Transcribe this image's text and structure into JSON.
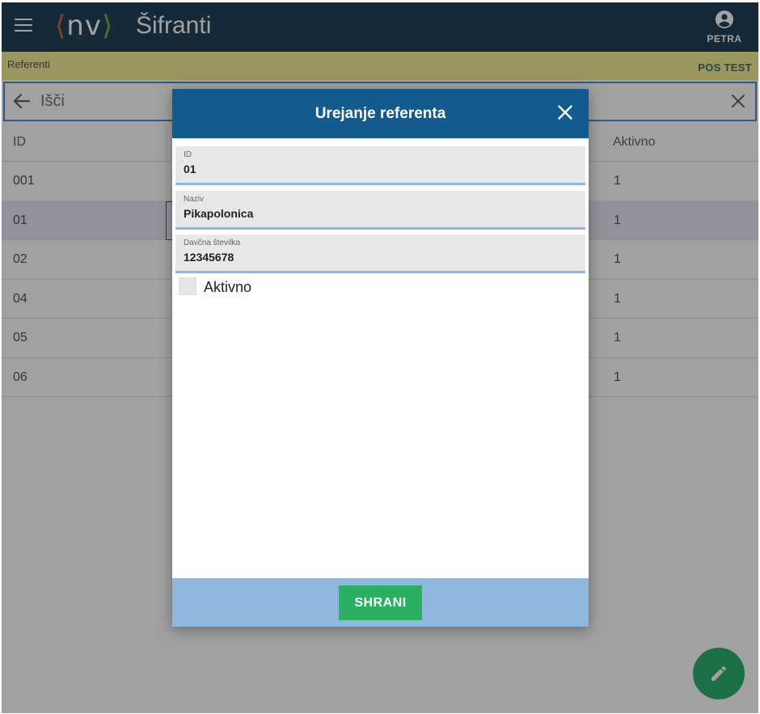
{
  "header": {
    "logo_open": "⟨",
    "logo_text": "nv",
    "logo_close": "⟩",
    "title": "Šifranti",
    "user_name": "PETRA",
    "menu_icon": "hamburger-menu-icon",
    "user_icon": "account-circle-icon"
  },
  "info_strip": {
    "breadcrumb": "Referenti",
    "environment": "POS TEST"
  },
  "search": {
    "placeholder": "Išči",
    "value": ""
  },
  "table": {
    "columns": [
      "ID",
      "Aktivno"
    ],
    "rows": [
      {
        "id": "001",
        "active": "1"
      },
      {
        "id": "01",
        "active": "1"
      },
      {
        "id": "02",
        "active": "1"
      },
      {
        "id": "04",
        "active": "1"
      },
      {
        "id": "05",
        "active": "1"
      },
      {
        "id": "06",
        "active": "1"
      }
    ]
  },
  "modal": {
    "title": "Urejanje referenta",
    "fields": {
      "id": {
        "label": "ID",
        "value": "01"
      },
      "name": {
        "label": "Naziv",
        "value": "Pikapolonica"
      },
      "tax": {
        "label": "Davčna številka",
        "value": "12345678"
      }
    },
    "active_label": "Aktivno",
    "active_checked": false,
    "save_label": "SHRANI"
  },
  "fab": {
    "icon": "pencil-edit-icon"
  },
  "colors": {
    "topbar": "#23425a",
    "info_strip": "#f4ee9c",
    "modal_header": "#135a8e",
    "modal_footer": "#8fb8de",
    "save": "#2ab060",
    "field_underline": "#8cb7e0"
  }
}
